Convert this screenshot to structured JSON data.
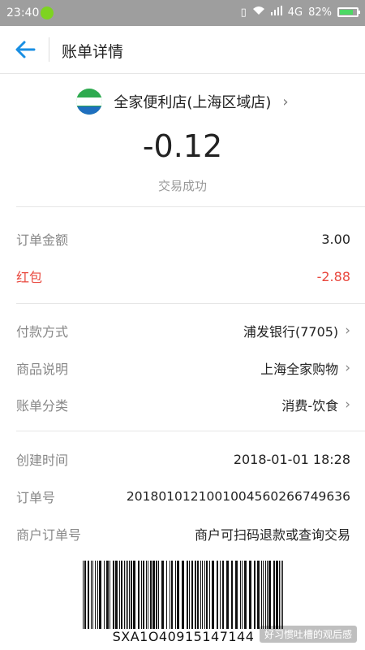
{
  "statusbar": {
    "time": "23:40",
    "network": "4G",
    "battery": "82%",
    "battery_level": 0.82
  },
  "header": {
    "title": "账单详情"
  },
  "merchant": {
    "name": "全家便利店(上海区域店)"
  },
  "transaction": {
    "amount": "-0.12",
    "status": "交易成功"
  },
  "details": {
    "order_amount": {
      "label": "订单金额",
      "value": "3.00"
    },
    "red_packet": {
      "label": "红包",
      "value": "-2.88"
    },
    "payment_method": {
      "label": "付款方式",
      "value": "浦发银行(7705)"
    },
    "item_desc": {
      "label": "商品说明",
      "value": "上海全家购物"
    },
    "category": {
      "label": "账单分类",
      "value": "消费-饮食"
    },
    "created_at": {
      "label": "创建时间",
      "value": "2018-01-01 18:28"
    },
    "order_no": {
      "label": "订单号",
      "value": "2018010121001004560266749636"
    },
    "merchant_order_no": {
      "label": "商户订单号",
      "value": "商户可扫码退款或查询交易"
    }
  },
  "barcode": {
    "text": "SXA1O40915147144"
  },
  "watermark": "好习惯吐槽的观后感",
  "colors": {
    "accent": "#1a8fe3",
    "negative": "#e9493f",
    "muted": "#888888",
    "logo_green": "#2eaa4f"
  }
}
